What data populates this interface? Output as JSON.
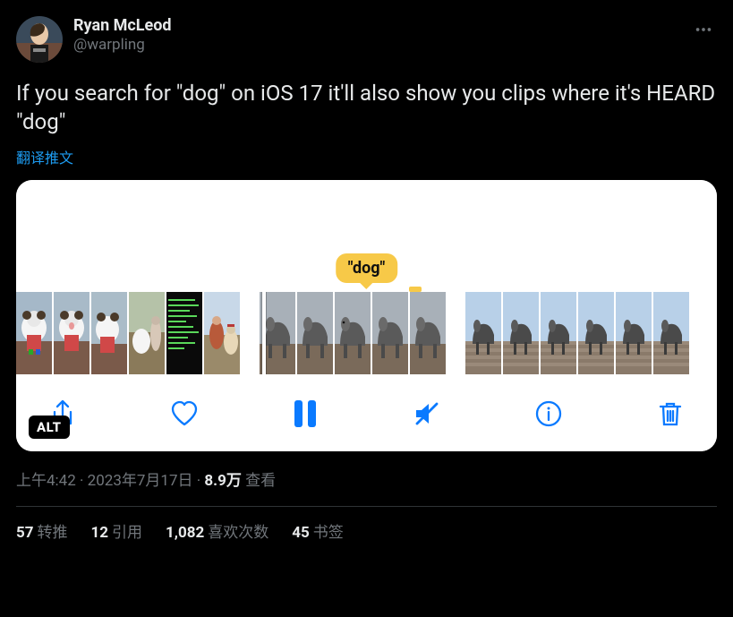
{
  "tweet": {
    "author": {
      "name": "Ryan McLeod",
      "handle": "@warpling"
    },
    "body": "If you search for \"dog\" on iOS 17 it'll also show you clips where it's HEARD \"dog\"",
    "translate_label": "翻译推文",
    "media": {
      "bubble_text": "\"dog\"",
      "alt_badge": "ALT"
    },
    "meta": {
      "time": "上午4:42",
      "dot1": " · ",
      "date": "2023年7月17日",
      "dot2": " · ",
      "views_count": "8.9万",
      "views_label": " 查看"
    },
    "stats": {
      "retweets": {
        "count": "57",
        "label": "转推"
      },
      "quotes": {
        "count": "12",
        "label": "引用"
      },
      "likes": {
        "count": "1,082",
        "label": "喜欢次数"
      },
      "bookmarks": {
        "count": "45",
        "label": "书签"
      }
    }
  }
}
